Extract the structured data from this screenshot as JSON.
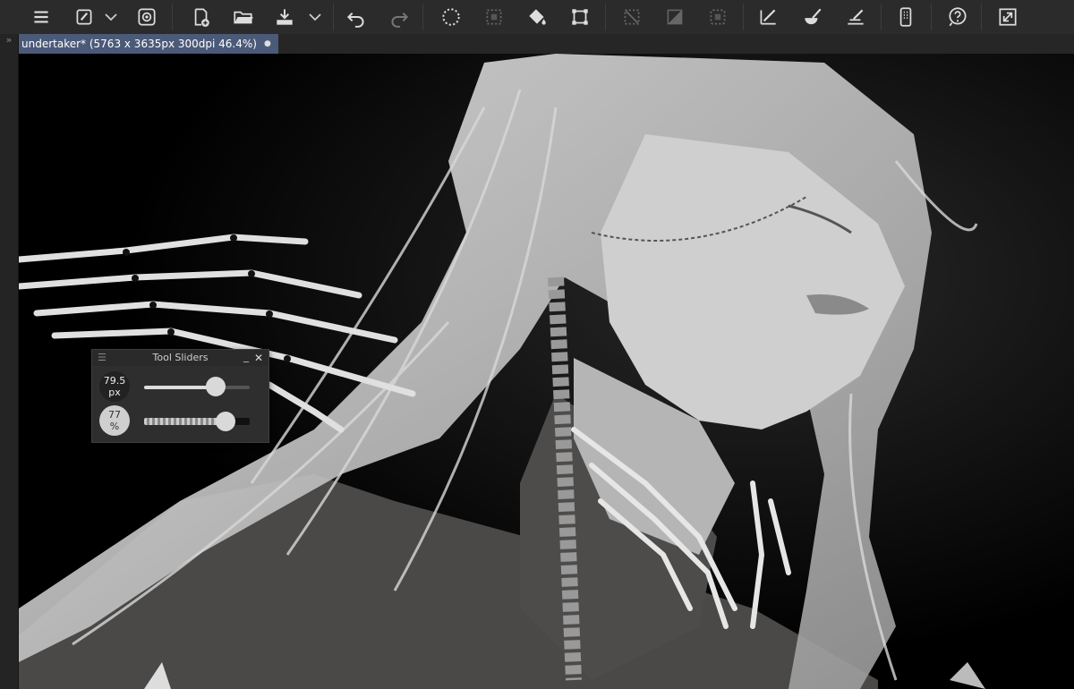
{
  "document_tab": {
    "title": "undertaker* (5763 x 3635px 300dpi 46.4%)",
    "modified_indicator": "●"
  },
  "left_panel": {
    "collapse_glyph": "»"
  },
  "toolbar": {
    "icons": [
      "menu-icon",
      "brush-preset-icon",
      "chevron-down-icon",
      "swirl-icon",
      "new-document-icon",
      "open-folder-icon",
      "save-icon",
      "chevron-down-icon",
      "undo-icon",
      "redo-icon",
      "select-all-icon",
      "deselect-icon",
      "fill-icon",
      "transform-icon",
      "mirror-horizontal-icon",
      "gradient-icon",
      "wrap-around-icon",
      "brush-settings-icon",
      "mix-brush-icon",
      "canvas-rotate-icon",
      "popup-palette-icon",
      "help-icon",
      "fullscreen-icon"
    ]
  },
  "tool_sliders": {
    "title": "Tool Sliders",
    "menu_glyph": "☰",
    "minimize_glyph": "_",
    "close_glyph": "✕",
    "size": {
      "value": "79.5",
      "unit": "px",
      "fraction": 0.68
    },
    "opacity": {
      "value": "77",
      "unit": "%",
      "fraction": 0.77
    }
  },
  "colors": {
    "tab_active": "#4b5a78",
    "toolbar_bg": "#2b2b2b",
    "canvas_bg": "#000000"
  }
}
